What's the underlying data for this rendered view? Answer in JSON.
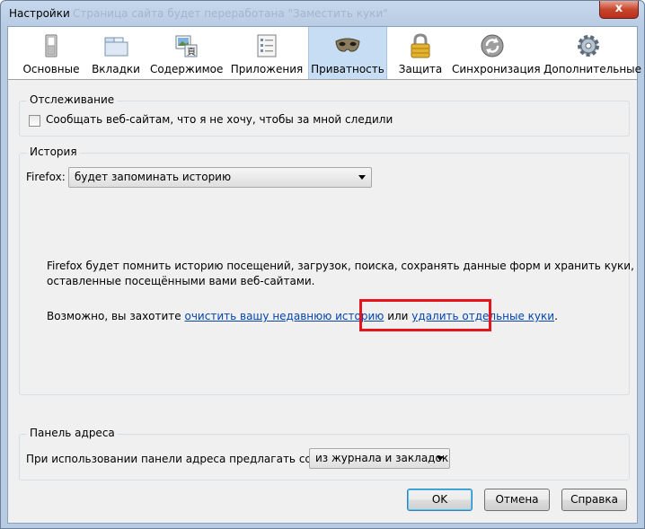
{
  "window": {
    "title": "Настройки",
    "ghost_title": "Страница сайта будет переработана \"Заместить куки\"",
    "close_label": "x"
  },
  "toolbar": {
    "tabs": [
      {
        "label": "Основные",
        "icon": "general-switch-icon"
      },
      {
        "label": "Вкладки",
        "icon": "tabs-window-icon"
      },
      {
        "label": "Содержимое",
        "icon": "content-pictures-icon"
      },
      {
        "label": "Приложения",
        "icon": "applications-list-icon"
      },
      {
        "label": "Приватность",
        "icon": "privacy-mask-icon"
      },
      {
        "label": "Защита",
        "icon": "security-padlock-icon"
      },
      {
        "label": "Синхронизация",
        "icon": "sync-arrows-icon"
      },
      {
        "label": "Дополнительные",
        "icon": "advanced-gear-icon"
      }
    ],
    "selected": "Приватность"
  },
  "tracking": {
    "legend": "Отслеживание",
    "dnt_label": "Сообщать веб-сайтам, что я не хочу, чтобы за мной следили",
    "dnt_checked": false
  },
  "history": {
    "legend": "История",
    "firefox_label": "Firefox:",
    "mode_value": "будет запоминать историю",
    "description_line1": "Firefox будет помнить историю посещений, загрузок, поиска, сохранять данные форм и хранить куки,",
    "description_line2": "оставленные посещёнными вами веб-сайтами.",
    "maybe_text": "Возможно, вы захотите ",
    "clear_link": "очистить вашу недавнюю историю",
    "or_text": " или ",
    "remove_cookies_link": "удалить отдельные куки",
    "period": "."
  },
  "address_bar": {
    "legend": "Панель адреса",
    "suggest_label": "При использовании панели адреса предлагать ссылки:",
    "suggest_value": "из журнала и закладок"
  },
  "buttons": {
    "ok": "OK",
    "cancel": "Отмена",
    "help": "Справка"
  },
  "colors": {
    "highlight": "#e8141c",
    "link": "#0645ad",
    "selected_tab": "#c6ddf4"
  }
}
